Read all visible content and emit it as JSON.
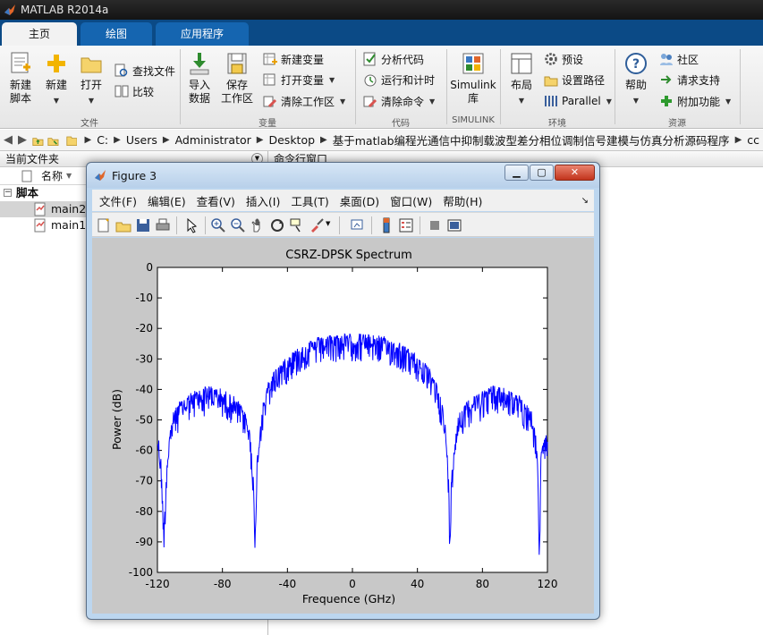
{
  "window": {
    "title": "MATLAB R2014a"
  },
  "tabs": [
    {
      "label": "主页",
      "active": true
    },
    {
      "label": "绘图",
      "active": false
    },
    {
      "label": "应用程序",
      "active": false
    }
  ],
  "ribbon": {
    "file": {
      "group_label": "文件",
      "new_script": "新建\n脚本",
      "new": "新建",
      "open": "打开",
      "find_files": "查找文件",
      "compare": "比较"
    },
    "variable": {
      "group_label": "变量",
      "import_data": "导入\n数据",
      "save_workspace": "保存\n工作区",
      "new_variable": "新建变量",
      "open_variable": "打开变量",
      "clear_workspace": "清除工作区"
    },
    "code": {
      "group_label": "代码",
      "analyze_code": "分析代码",
      "run_and_time": "运行和计时",
      "clear_commands": "清除命令"
    },
    "simulink": {
      "group_label": "SIMULINK",
      "library": "Simulink\n库"
    },
    "environment": {
      "group_label": "环境",
      "layout": "布局",
      "preferences": "预设",
      "set_path": "设置路径",
      "parallel": "Parallel"
    },
    "resources": {
      "group_label": "资源",
      "help": "帮助",
      "community": "社区",
      "request_support": "请求支持",
      "addons": "附加功能"
    }
  },
  "address": {
    "crumbs": [
      "C:",
      "Users",
      "Administrator",
      "Desktop",
      "基于matlab编程光通信中抑制载波型差分相位调制信号建模与仿真分析源码程序",
      "cc"
    ]
  },
  "current_folder": {
    "title": "当前文件夹",
    "column_name": "名称",
    "folder": "脚本",
    "files": [
      "main2.m",
      "main1.m"
    ]
  },
  "command_window": {
    "title": "命令行窗口"
  },
  "figure": {
    "title": "Figure 3",
    "menu": [
      "文件(F)",
      "编辑(E)",
      "查看(V)",
      "插入(I)",
      "工具(T)",
      "桌面(D)",
      "窗口(W)",
      "帮助(H)"
    ]
  },
  "colors": {
    "accent": "#0b4a86",
    "trace": "#0000ff",
    "fig_bg": "#c8c8c8"
  },
  "chart_data": {
    "type": "line",
    "title": "CSRZ-DPSK Spectrum",
    "xlabel": "Frequence (GHz)",
    "ylabel": "Power (dB)",
    "xlim": [
      -120,
      120
    ],
    "ylim": [
      -100,
      0
    ],
    "xticks": [
      -120,
      -80,
      -40,
      0,
      40,
      80,
      120
    ],
    "yticks": [
      0,
      -10,
      -20,
      -30,
      -40,
      -50,
      -60,
      -70,
      -80,
      -90,
      -100
    ],
    "grid": false,
    "series": [
      {
        "color": "#0000ff",
        "x": [
          -120,
          -118,
          -116,
          -114,
          -112,
          -110,
          -106,
          -102,
          -98,
          -94,
          -90,
          -86,
          -82,
          -78,
          -74,
          -70,
          -66,
          -63,
          -61,
          -60,
          -59,
          -57,
          -55,
          -52,
          -48,
          -44,
          -40,
          -35,
          -30,
          -25,
          -20,
          -15,
          -10,
          -5,
          0,
          5,
          10,
          15,
          20,
          25,
          30,
          35,
          40,
          44,
          48,
          52,
          55,
          57,
          59,
          60,
          61,
          63,
          66,
          70,
          74,
          78,
          82,
          86,
          90,
          94,
          98,
          102,
          106,
          110,
          112,
          114,
          115,
          116,
          118,
          120
        ],
        "y": [
          -55,
          -62,
          -86,
          -62,
          -53,
          -48,
          -45,
          -43,
          -42,
          -41,
          -40,
          -40,
          -41,
          -42,
          -43,
          -45,
          -48,
          -55,
          -67,
          -93,
          -66,
          -52,
          -45,
          -39,
          -35,
          -32,
          -30,
          -28,
          -26,
          -25,
          -24,
          -23.5,
          -23,
          -23,
          -23,
          -23,
          -23,
          -23.5,
          -24,
          -25,
          -26,
          -28,
          -30,
          -32,
          -35,
          -39,
          -45,
          -52,
          -66,
          -89,
          -67,
          -55,
          -48,
          -45,
          -43,
          -42,
          -41,
          -40,
          -40,
          -41,
          -42,
          -43,
          -45,
          -48,
          -53,
          -62,
          -97,
          -62,
          -57,
          -54
        ]
      }
    ]
  }
}
